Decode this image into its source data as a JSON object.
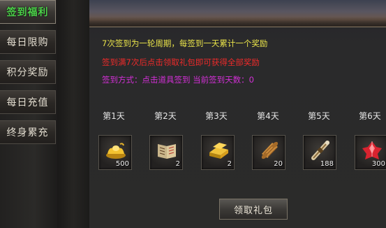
{
  "sidebar": {
    "items": [
      {
        "label": "签到福利",
        "active": true
      },
      {
        "label": "每日限购",
        "active": false
      },
      {
        "label": "积分奖励",
        "active": false
      },
      {
        "label": "每日充值",
        "active": false
      },
      {
        "label": "终身累充",
        "active": false
      }
    ]
  },
  "info": {
    "line1": "7次签到为一轮周期，每签到一天累计一个奖励",
    "line2": "签到满7次后点击领取礼包即可获得全部奖励",
    "line3": "签到方式：点击道具签到  当前签到天数：0"
  },
  "days": [
    {
      "label": "第1天",
      "item": "gold-ingot-icon",
      "qty": "500"
    },
    {
      "label": "第2天",
      "item": "skill-book-icon",
      "qty": "2"
    },
    {
      "label": "第3天",
      "item": "gold-bars-icon",
      "qty": "2"
    },
    {
      "label": "第4天",
      "item": "scroll-icon",
      "qty": "20"
    },
    {
      "label": "第5天",
      "item": "telescope-icon",
      "qty": "188"
    },
    {
      "label": "第6天",
      "item": "red-crystal-icon",
      "qty": "300"
    }
  ],
  "claim_button": "领取礼包",
  "colors": {
    "active_tab_text": "#4cd24a",
    "line1": "#e9e34a",
    "line2": "#ee2a2a",
    "line3": "#d22fd6"
  }
}
